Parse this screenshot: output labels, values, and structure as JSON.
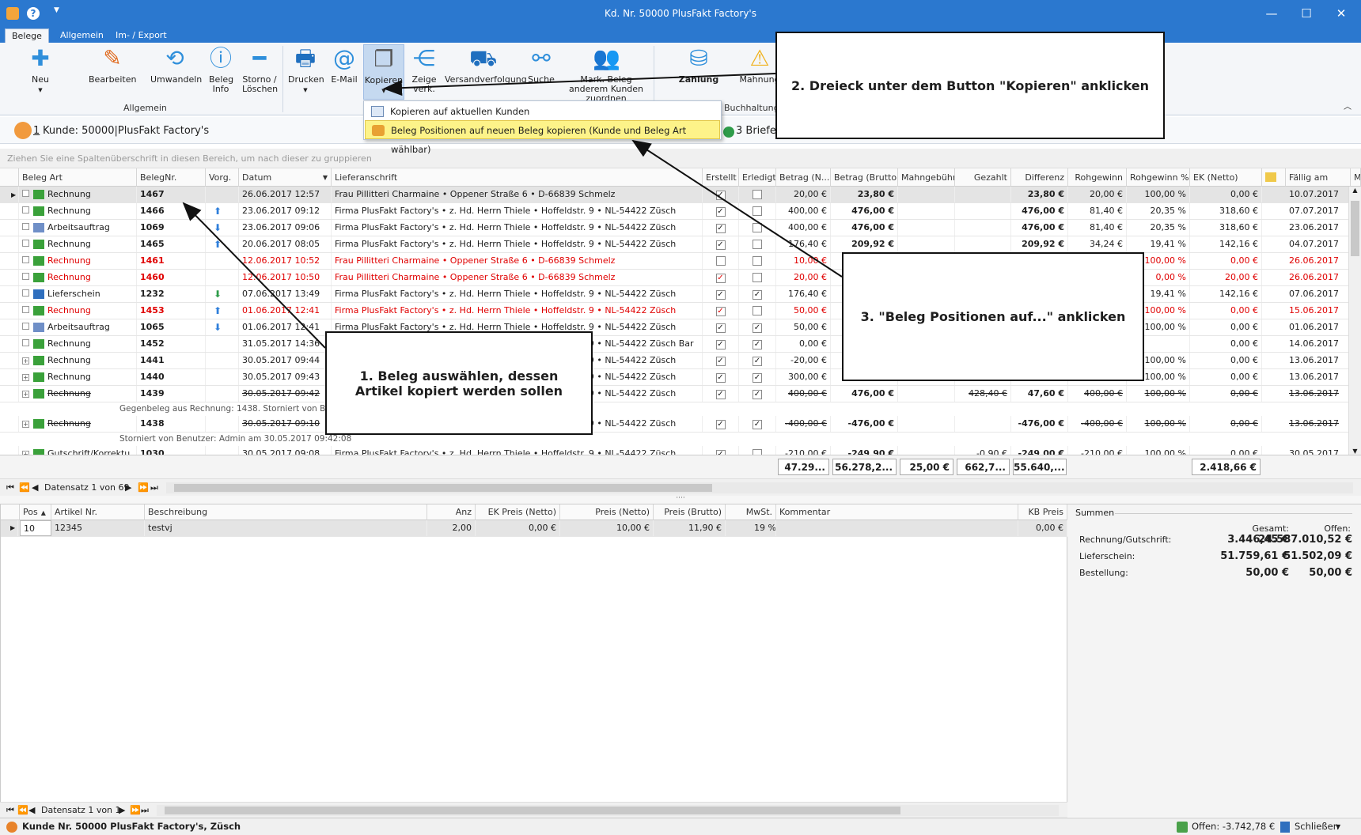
{
  "window": {
    "title": "Kd. Nr. 50000 PlusFakt Factory's"
  },
  "tabs": [
    "Belege",
    "Allgemein",
    "Im- / Export"
  ],
  "ribbon": {
    "buttons": [
      {
        "label": "Neu",
        "icon": "plus-icon"
      },
      {
        "label": "Bearbeiten",
        "icon": "pencil-icon"
      },
      {
        "label": "Umwandeln",
        "icon": "convert-icon"
      },
      {
        "label": "Beleg Info",
        "icon": "info-icon"
      },
      {
        "label": "Storno / Löschen",
        "icon": "minus-icon"
      },
      {
        "label": "Drucken",
        "icon": "printer-icon"
      },
      {
        "label": "E-Mail",
        "icon": "email-icon"
      },
      {
        "label": "Kopieren",
        "icon": "copy-icon"
      },
      {
        "label": "Zeige verk.",
        "icon": "share-icon"
      },
      {
        "label": "Versandverfolgung",
        "icon": "truck-icon"
      },
      {
        "label": "Suche",
        "icon": "binoculars-icon"
      },
      {
        "label": "Mark. Beleg anderem Kunden zuordnen",
        "icon": "users-icon"
      },
      {
        "label": "Zahlung",
        "icon": "payment-icon"
      },
      {
        "label": "Mahnung",
        "icon": "reminder-icon"
      }
    ],
    "group_allgemein": "Allgemein",
    "group_buchhaltung": "Buchhaltung"
  },
  "dropdown": {
    "items": [
      "Kopieren auf aktuellen Kunden",
      "Beleg Positionen auf neuen Beleg kopieren (Kunde und Beleg Art wählbar)"
    ]
  },
  "customer_bar": {
    "count": "1",
    "label": "Kunde: 50000|PlusFakt Factory's",
    "briefe": "3 Briefe/"
  },
  "group_hint": "Ziehen Sie eine Spaltenüberschrift in diesen Bereich, um nach dieser zu gruppieren",
  "columns": [
    "Beleg Art",
    "BelegNr.",
    "Vorg.",
    "Datum",
    "Lieferanschrift",
    "Erstellt",
    "Erledigt",
    "Betrag (N...",
    "Betrag (Brutto)",
    "Mahngebühr",
    "Gezahlt",
    "Differenz",
    "Rohgewinn",
    "Rohgewinn %",
    "EK (Netto)",
    "",
    "Fällig am",
    "M"
  ],
  "rows": [
    {
      "art": "Rechnung",
      "nr": "1467",
      "vorg": "",
      "datum": "26.06.2017 12:57",
      "adr": "Frau Pillitteri Charmaine • Oppener Straße 6 • D-66839 Schmelz",
      "erst": true,
      "erl": false,
      "netto": "20,00 €",
      "brutto": "23,80 €",
      "mahn": "",
      "gez": "",
      "diff": "23,80 €",
      "roh": "20,00 €",
      "rohp": "100,00 %",
      "ek": "0,00 €",
      "faell": "10.07.2017",
      "style": "sel"
    },
    {
      "art": "Rechnung",
      "nr": "1466",
      "vorg": "up",
      "datum": "23.06.2017 09:12",
      "adr": "Firma PlusFakt Factory's • z. Hd. Herrn Thiele • Hoffeldstr. 9 • NL-54422 Züsch",
      "erst": true,
      "erl": false,
      "netto": "400,00 €",
      "brutto": "476,00 €",
      "mahn": "",
      "gez": "",
      "diff": "476,00 €",
      "roh": "81,40 €",
      "rohp": "20,35 %",
      "ek": "318,60 €",
      "faell": "07.07.2017",
      "style": ""
    },
    {
      "art": "Arbeitsauftrag",
      "nr": "1069",
      "vorg": "down",
      "datum": "23.06.2017 09:06",
      "adr": "Firma PlusFakt Factory's • z. Hd. Herrn Thiele • Hoffeldstr. 9 • NL-54422 Züsch",
      "erst": true,
      "erl": false,
      "netto": "400,00 €",
      "brutto": "476,00 €",
      "mahn": "",
      "gez": "",
      "diff": "476,00 €",
      "roh": "81,40 €",
      "rohp": "20,35 %",
      "ek": "318,60 €",
      "faell": "23.06.2017",
      "style": ""
    },
    {
      "art": "Rechnung",
      "nr": "1465",
      "vorg": "up",
      "datum": "20.06.2017 08:05",
      "adr": "Firma PlusFakt Factory's • z. Hd. Herrn Thiele • Hoffeldstr. 9 • NL-54422 Züsch",
      "erst": true,
      "erl": false,
      "netto": "176,40 €",
      "brutto": "209,92 €",
      "mahn": "",
      "gez": "",
      "diff": "209,92 €",
      "roh": "34,24 €",
      "rohp": "19,41 %",
      "ek": "142,16 €",
      "faell": "04.07.2017",
      "style": ""
    },
    {
      "art": "Rechnung",
      "nr": "1461",
      "vorg": "",
      "datum": "12.06.2017 10:52",
      "adr": "Frau Pillitteri Charmaine • Oppener Straße 6 • D-66839 Schmelz",
      "erst": false,
      "erl": false,
      "netto": "10,00 €",
      "brutto": "",
      "mahn": "",
      "gez": "",
      "diff": "",
      "roh": "",
      "rohp": "100,00 %",
      "ek": "0,00 €",
      "faell": "26.06.2017",
      "style": "red"
    },
    {
      "art": "Rechnung",
      "nr": "1460",
      "vorg": "",
      "datum": "12.06.2017 10:50",
      "adr": "Frau Pillitteri Charmaine • Oppener Straße 6 • D-66839 Schmelz",
      "erst": true,
      "erl": false,
      "netto": "20,00 €",
      "brutto": "",
      "mahn": "",
      "gez": "",
      "diff": "",
      "roh": "",
      "rohp": "0,00 %",
      "ek": "20,00 €",
      "faell": "26.06.2017",
      "style": "red"
    },
    {
      "art": "Lieferschein",
      "nr": "1232",
      "vorg": "green",
      "datum": "07.06.2017 13:49",
      "adr": "Firma PlusFakt Factory's • z. Hd. Herrn Thiele • Hoffeldstr. 9 • NL-54422 Züsch",
      "erst": true,
      "erl": true,
      "netto": "176,40 €",
      "brutto": "",
      "mahn": "",
      "gez": "",
      "diff": "",
      "roh": "",
      "rohp": "19,41 %",
      "ek": "142,16 €",
      "faell": "07.06.2017",
      "style": ""
    },
    {
      "art": "Rechnung",
      "nr": "1453",
      "vorg": "up",
      "datum": "01.06.2017 12:41",
      "adr": "Firma PlusFakt Factory's • z. Hd. Herrn Thiele • Hoffeldstr. 9 • NL-54422 Züsch",
      "erst": true,
      "erl": false,
      "netto": "50,00 €",
      "brutto": "",
      "mahn": "",
      "gez": "",
      "diff": "",
      "roh": "",
      "rohp": "100,00 %",
      "ek": "0,00 €",
      "faell": "15.06.2017",
      "style": "red"
    },
    {
      "art": "Arbeitsauftrag",
      "nr": "1065",
      "vorg": "down",
      "datum": "01.06.2017 12:41",
      "adr": "Firma PlusFakt Factory's • z. Hd. Herrn Thiele • Hoffeldstr. 9 • NL-54422 Züsch",
      "erst": true,
      "erl": true,
      "netto": "50,00 €",
      "brutto": "",
      "mahn": "",
      "gez": "",
      "diff": "",
      "roh": "",
      "rohp": "100,00 %",
      "ek": "0,00 €",
      "faell": "01.06.2017",
      "style": ""
    },
    {
      "art": "Rechnung",
      "nr": "1452",
      "vorg": "",
      "datum": "31.05.2017 14:36",
      "adr": "Firma PlusFakt Factory's • z. Hd. Herrn Thiele • Hoffeldstr. 9 • NL-54422 Züsch Bar",
      "erst": true,
      "erl": true,
      "netto": "0,00 €",
      "brutto": "",
      "mahn": "",
      "gez": "",
      "diff": "",
      "roh": "",
      "rohp": "",
      "ek": "0,00 €",
      "faell": "14.06.2017",
      "style": ""
    },
    {
      "art": "Rechnung",
      "nr": "1441",
      "vorg": "",
      "datum": "30.05.2017 09:44",
      "adr": "Firma PlusFakt Factory's • z. Hd. Herrn Thiele • Hoffeldstr. 9 • NL-54422 Züsch",
      "erst": true,
      "erl": true,
      "netto": "-20,00 €",
      "brutto": "",
      "mahn": "",
      "gez": "",
      "diff": "",
      "roh": "",
      "rohp": "100,00 %",
      "ek": "0,00 €",
      "faell": "13.06.2017",
      "style": "plus"
    },
    {
      "art": "Rechnung",
      "nr": "1440",
      "vorg": "",
      "datum": "30.05.2017 09:43",
      "adr": "Firma PlusFakt Factory's • z. Hd. Herrn Thiele • Hoffeldstr. 9 • NL-54422 Züsch",
      "erst": true,
      "erl": true,
      "netto": "300,00 €",
      "brutto": "",
      "mahn": "",
      "gez": "",
      "diff": "",
      "roh": "",
      "rohp": "100,00 %",
      "ek": "0,00 €",
      "faell": "13.06.2017",
      "style": "plus"
    },
    {
      "art": "Rechnung",
      "nr": "1439",
      "vorg": "",
      "datum": "30.05.2017 09:42",
      "adr": "Firma PlusFakt Factory's • z. Hd. Herrn Thiele • Hoffeldstr. 9 • NL-54422 Züsch",
      "erst": true,
      "erl": true,
      "netto": "400,00 €",
      "brutto": "476,00 €",
      "mahn": "",
      "gez": "428,40 €",
      "diff": "47,60 €",
      "roh": "400,00 €",
      "rohp": "100,00 %",
      "ek": "0,00 €",
      "faell": "13.06.2017",
      "style": "strike",
      "sub": "Gegenbeleg aus Rechnung: 1438. Storniert von Benutzer: Admin am 30.05.2017 09:42:08"
    },
    {
      "art": "Rechnung",
      "nr": "1438",
      "vorg": "",
      "datum": "30.05.2017 09:10",
      "adr": "Firma PlusFakt Factory's • z. Hd. Herrn Thiele • Hoffeldstr. 9 • NL-54422 Züsch",
      "erst": true,
      "erl": true,
      "netto": "-400,00 €",
      "brutto": "-476,00 €",
      "mahn": "",
      "gez": "",
      "diff": "-476,00 €",
      "roh": "-400,00 €",
      "rohp": "100,00 %",
      "ek": "0,00 €",
      "faell": "13.06.2017",
      "style": "strike",
      "sub": "Storniert von Benutzer: Admin am 30.05.2017 09:42:08"
    },
    {
      "art": "Gutschrift/Korrektu...",
      "nr": "1030",
      "vorg": "",
      "datum": "30.05.2017 09:08",
      "adr": "Firma PlusFakt Factory's • z. Hd. Herrn Thiele • Hoffeldstr. 9 • NL-54422 Züsch",
      "erst": true,
      "erl": false,
      "netto": "-210,00 €",
      "brutto": "-249,90 €",
      "mahn": "",
      "gez": "-0,90 €",
      "diff": "-249,00 €",
      "roh": "-210,00 €",
      "rohp": "100,00 %",
      "ek": "0,00 €",
      "faell": "30.05.2017",
      "style": "plus"
    }
  ],
  "sums": {
    "netto": "47.29...",
    "brutto": "56.278,2...",
    "mahn": "25,00 €",
    "gez": "662,7...",
    "diff": "55.640,...",
    "ek": "2.418,66 €"
  },
  "nav1": "Datensatz 1 von 69",
  "lower": {
    "columns": [
      "Pos",
      "Artikel Nr.",
      "Beschreibung",
      "Anz",
      "EK Preis (Netto)",
      "Preis (Netto)",
      "Preis (Brutto)",
      "MwSt.",
      "Kommentar",
      "KB Preis"
    ],
    "rows": [
      {
        "pos": "10",
        "art": "12345",
        "desc": "testvj",
        "anz": "2,00",
        "ek": "0,00 €",
        "netto": "10,00 €",
        "brutto": "11,90 €",
        "mwst": "19 %",
        "komm": "",
        "kb": "0,00 €"
      }
    ],
    "nav": "Datensatz 1 von 1"
  },
  "summen": {
    "title": "Summen",
    "head_gesamt": "Gesamt:",
    "head_offen": "Offen:",
    "lines": [
      {
        "label": "Rechnung/Gutschrift:",
        "gesamt": "3.446,45 €",
        "offen": "24.587.010,52 €"
      },
      {
        "label": "Lieferschein:",
        "gesamt": "51.759,61 €",
        "offen": "51.502,09 €"
      },
      {
        "label": "Bestellung:",
        "gesamt": "50,00 €",
        "offen": "50,00 €"
      }
    ]
  },
  "status": {
    "left": "Kunde Nr. 50000 PlusFakt Factory's, Züsch",
    "offen": "Offen: -3.742,78 €",
    "schliessen": "Schließen"
  },
  "callouts": {
    "c1": "1. Beleg auswählen, dessen Artikel kopiert werden sollen",
    "c2": "2. Dreieck unter dem Button \"Kopieren\" anklicken",
    "c3": "3. \"Beleg Positionen auf...\" anklicken"
  },
  "colors": {
    "titlebar": "#2b78cf",
    "highlight": "#fdf389",
    "red": "#e00000"
  }
}
